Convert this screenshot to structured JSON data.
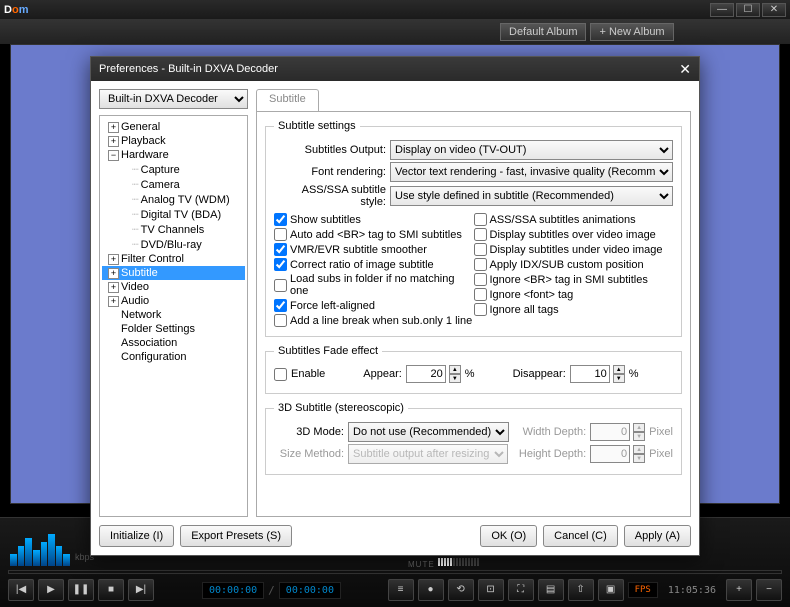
{
  "app": {
    "logo_d": "D",
    "logo_o": "o",
    "logo_m": "m"
  },
  "album_bar": {
    "default": "Default Album",
    "new": "+ New Album"
  },
  "pref": {
    "title": "Preferences - Built-in DXVA Decoder",
    "dropdown": "Built-in DXVA Decoder",
    "tree": {
      "general": "General",
      "playback": "Playback",
      "hardware": "Hardware",
      "capture": "Capture",
      "camera": "Camera",
      "analog_tv": "Analog TV (WDM)",
      "digital_tv": "Digital TV (BDA)",
      "tv_channels": "TV Channels",
      "dvd": "DVD/Blu-ray",
      "filter_control": "Filter Control",
      "subtitle": "Subtitle",
      "video": "Video",
      "audio": "Audio",
      "network": "Network",
      "folder_settings": "Folder Settings",
      "association": "Association",
      "configuration": "Configuration"
    },
    "tab": "Subtitle",
    "subtitle_settings": {
      "legend": "Subtitle settings",
      "output_label": "Subtitles Output:",
      "output_value": "Display on video (TV-OUT)",
      "font_label": "Font rendering:",
      "font_value": "Vector text rendering - fast, invasive quality (Recomm",
      "ass_label": "ASS/SSA subtitle style:",
      "ass_value": "Use style defined in subtitle (Recommended)",
      "cb_left": [
        {
          "label": "Show subtitles",
          "checked": true
        },
        {
          "label": "Auto add <BR> tag to SMI subtitles",
          "checked": false
        },
        {
          "label": "VMR/EVR subtitle smoother",
          "checked": true
        },
        {
          "label": "Correct ratio of image subtitle",
          "checked": true
        },
        {
          "label": "Load subs in folder if no matching one",
          "checked": false
        },
        {
          "label": "Force left-aligned",
          "checked": true
        },
        {
          "label": "Add a line break when sub.only 1 line",
          "checked": false
        }
      ],
      "cb_right": [
        {
          "label": "ASS/SSA subtitles animations",
          "checked": false
        },
        {
          "label": "Display subtitles over video image",
          "checked": false
        },
        {
          "label": "Display subtitles under video image",
          "checked": false
        },
        {
          "label": "Apply IDX/SUB custom position",
          "checked": false
        },
        {
          "label": "Ignore <BR> tag in SMI subtitles",
          "checked": false
        },
        {
          "label": "Ignore <font> tag",
          "checked": false
        },
        {
          "label": "Ignore all tags",
          "checked": false
        }
      ]
    },
    "fade": {
      "legend": "Subtitles Fade effect",
      "enable": "Enable",
      "appear_label": "Appear:",
      "appear_value": "20",
      "pct": "%",
      "disappear_label": "Disappear:",
      "disappear_value": "10"
    },
    "stereo": {
      "legend": "3D Subtitle (stereoscopic)",
      "mode_label": "3D Mode:",
      "mode_value": "Do not use (Recommended)",
      "size_label": "Size Method:",
      "size_value": "Subtitle output after resizing",
      "width_label": "Width Depth:",
      "height_label": "Height Depth:",
      "depth_value": "0",
      "pixel": "Pixel"
    },
    "buttons": {
      "initialize": "Initialize (I)",
      "export": "Export Presets (S)",
      "ok": "OK (O)",
      "cancel": "Cancel (C)",
      "apply": "Apply (A)"
    }
  },
  "bottom": {
    "kbps": "kbps",
    "mute": "MUTE",
    "time1": "00:00:00",
    "time2": "00:00:00",
    "fps_label": "FPS",
    "clock": "11:05:36"
  }
}
